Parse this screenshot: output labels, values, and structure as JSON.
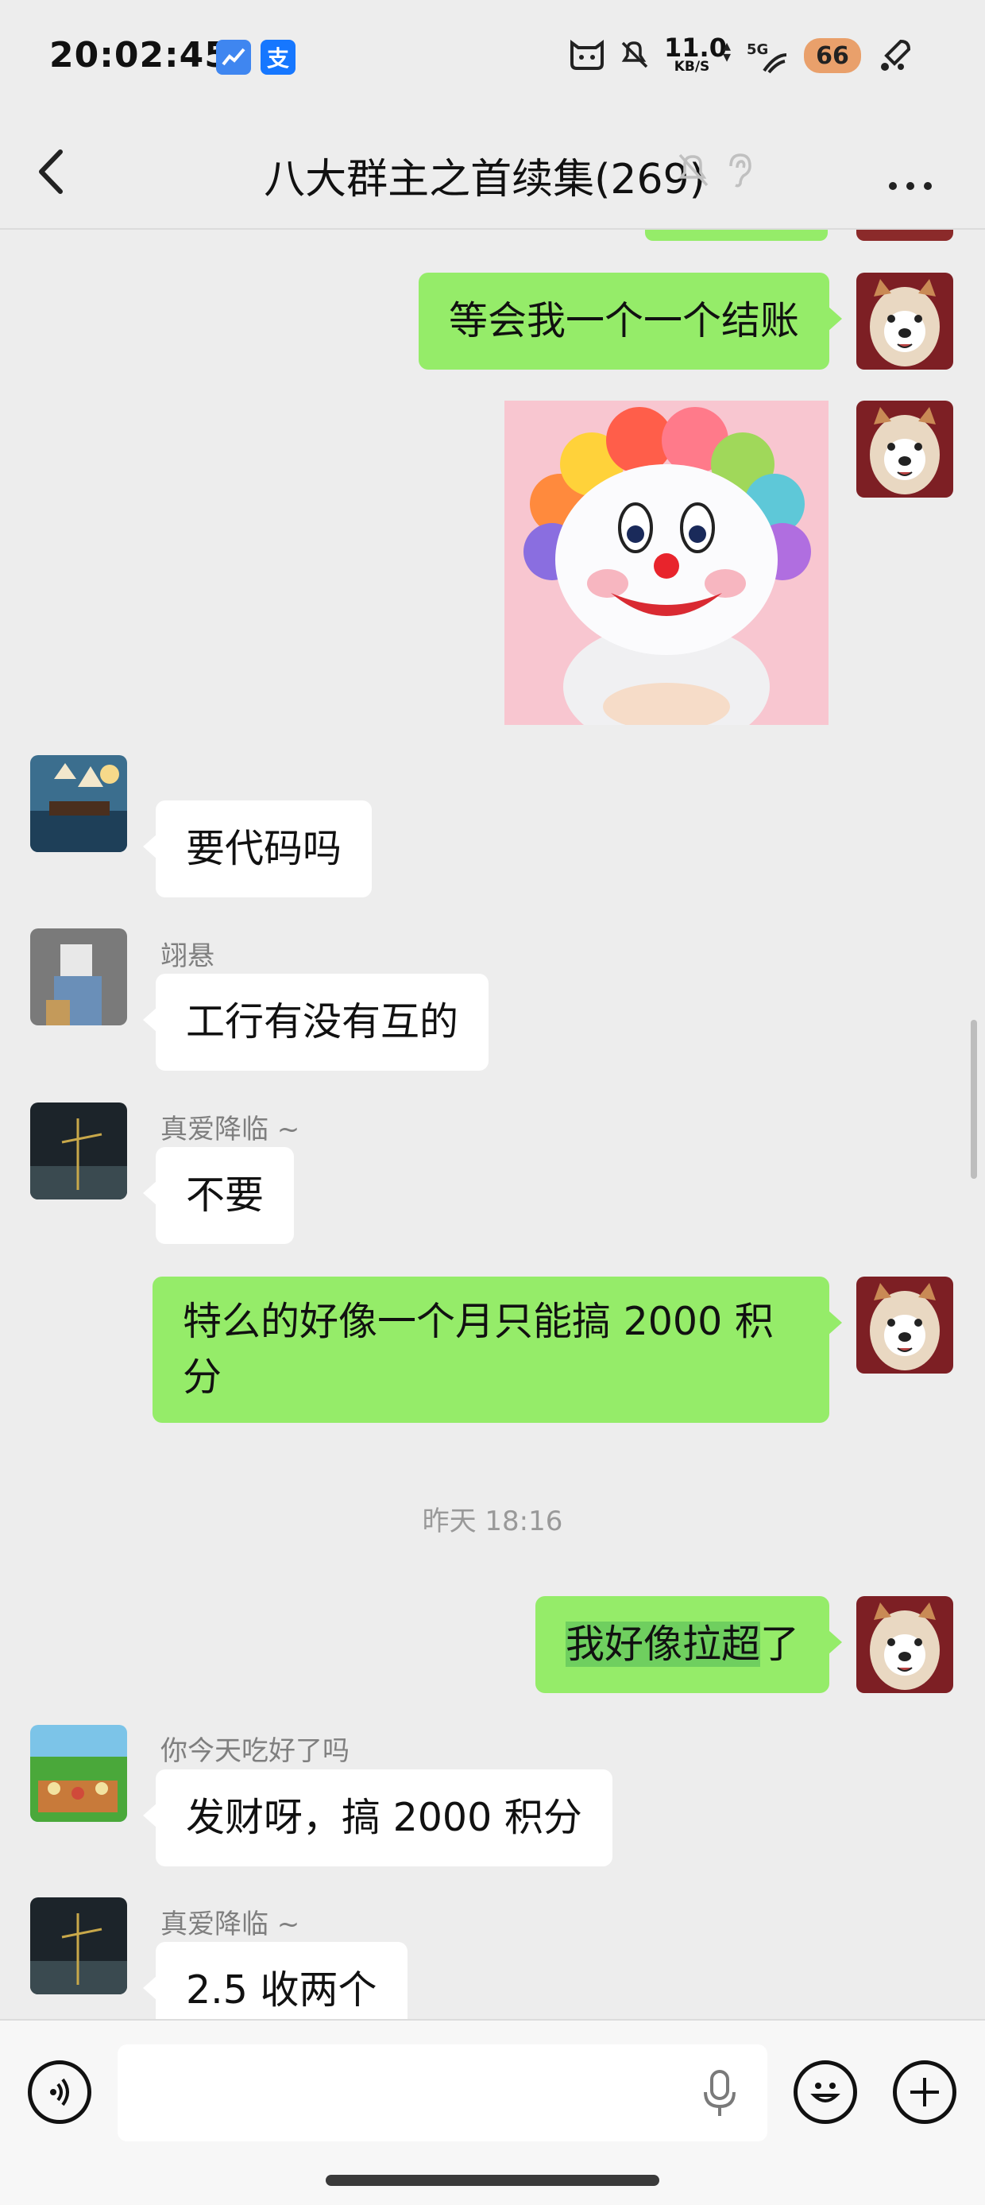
{
  "status_bar": {
    "time": "20:02:45",
    "net_speed_value": "11.0",
    "net_speed_unit": "KB/S",
    "signal": "5G",
    "battery": "66",
    "app_badge_2": "支"
  },
  "header": {
    "title": "八大群主之首续集(269)",
    "icons": [
      "back-arrow-icon",
      "muted-bell-icon",
      "ear-icon",
      "more-dots-icon"
    ]
  },
  "messages": [
    {
      "side": "out",
      "text": "等会我一个一个结账"
    },
    {
      "side": "out",
      "type": "sticker",
      "sticker": "clown-sticker"
    },
    {
      "side": "in",
      "sender": "",
      "text": "要代码吗"
    },
    {
      "side": "in",
      "sender": "翊悬",
      "text": "工行有没有互的"
    },
    {
      "side": "in",
      "sender": "真爱降临 ~",
      "text": "不要"
    },
    {
      "side": "out",
      "text_line1": "特么的好像一个月只能搞 2000 积",
      "text_line2": "分"
    },
    {
      "type": "timestamp",
      "text": "昨天 18:16"
    },
    {
      "side": "out",
      "text_a": "我好像拉超",
      "text_b": "了"
    },
    {
      "side": "in",
      "sender": "你今天吃好了吗",
      "text": "发财呀，搞 2000 积分"
    },
    {
      "side": "in",
      "sender": "真爱降临 ~",
      "text": "2.5 收两个"
    }
  ],
  "colors": {
    "background": "#ededed",
    "out_bubble": "#95ec69",
    "in_bubble": "#ffffff",
    "highlight": "#6fcf5f"
  }
}
